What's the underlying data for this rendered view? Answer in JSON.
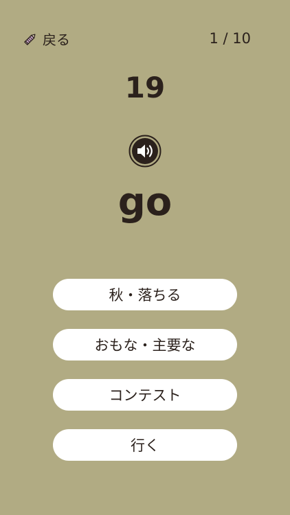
{
  "header": {
    "back_label": "戻る",
    "back_icon": "pencil-icon",
    "progress": "1 / 10"
  },
  "question": {
    "number": "19",
    "word": "go",
    "audio_icon": "speaker-icon"
  },
  "choices": [
    {
      "label": "秋・落ちる"
    },
    {
      "label": "おもな・主要な"
    },
    {
      "label": "コンテスト"
    },
    {
      "label": "行く"
    }
  ],
  "colors": {
    "background": "#b1ab83",
    "text": "#2b211c",
    "button": "#ffffff",
    "pencil": "#c9a6c9"
  }
}
